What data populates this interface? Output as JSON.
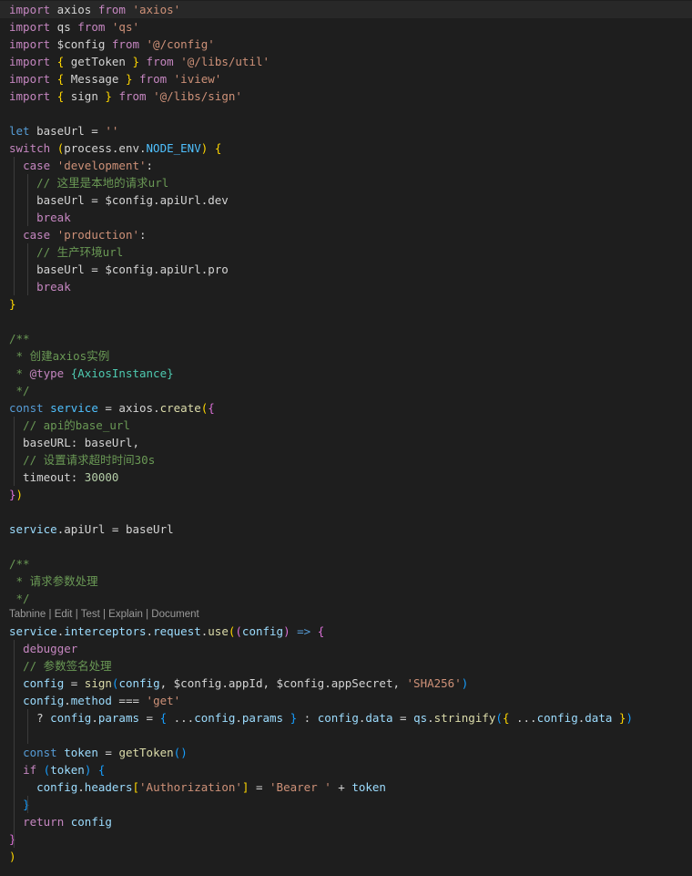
{
  "theme": {
    "background": "#1e1e1e",
    "current_line": "#282828",
    "colors": {
      "kw": "#c586c0",
      "kw2": "#569cd6",
      "str": "#ce9178",
      "var": "#9cdcfe",
      "fn": "#dcdcaa",
      "cls": "#4ec9b0",
      "num": "#b5cea8",
      "comment": "#6a9955",
      "const": "#4fc1ff",
      "plain": "#d4d4d4",
      "b1": "#ffd700",
      "b2": "#da70d6",
      "b3": "#179fff",
      "docTag": "#c586c0"
    }
  },
  "codelens": [
    "Tabnine",
    "Edit",
    "Test",
    "Explain",
    "Document"
  ],
  "lines": [
    [
      [
        "kw",
        "import"
      ],
      [
        "plain",
        " axios "
      ],
      [
        "kw",
        "from"
      ],
      [
        "plain",
        " "
      ],
      [
        "str",
        "'axios'"
      ]
    ],
    [
      [
        "kw",
        "import"
      ],
      [
        "plain",
        " qs "
      ],
      [
        "kw",
        "from"
      ],
      [
        "plain",
        " "
      ],
      [
        "str",
        "'qs'"
      ]
    ],
    [
      [
        "kw",
        "import"
      ],
      [
        "plain",
        " $config "
      ],
      [
        "kw",
        "from"
      ],
      [
        "plain",
        " "
      ],
      [
        "str",
        "'@/config'"
      ]
    ],
    [
      [
        "kw",
        "import"
      ],
      [
        "plain",
        " "
      ],
      [
        "b1",
        "{"
      ],
      [
        "plain",
        " getToken "
      ],
      [
        "b1",
        "}"
      ],
      [
        "plain",
        " "
      ],
      [
        "kw",
        "from"
      ],
      [
        "plain",
        " "
      ],
      [
        "str",
        "'@/libs/util'"
      ]
    ],
    [
      [
        "kw",
        "import"
      ],
      [
        "plain",
        " "
      ],
      [
        "b1",
        "{"
      ],
      [
        "plain",
        " Message "
      ],
      [
        "b1",
        "}"
      ],
      [
        "plain",
        " "
      ],
      [
        "kw",
        "from"
      ],
      [
        "plain",
        " "
      ],
      [
        "str",
        "'iview'"
      ]
    ],
    [
      [
        "kw",
        "import"
      ],
      [
        "plain",
        " "
      ],
      [
        "b1",
        "{"
      ],
      [
        "plain",
        " sign "
      ],
      [
        "b1",
        "}"
      ],
      [
        "plain",
        " "
      ],
      [
        "kw",
        "from"
      ],
      [
        "plain",
        " "
      ],
      [
        "str",
        "'@/libs/sign'"
      ]
    ],
    [],
    [
      [
        "kw2",
        "let"
      ],
      [
        "plain",
        " baseUrl = "
      ],
      [
        "str",
        "''"
      ]
    ],
    [
      [
        "kw",
        "switch"
      ],
      [
        "plain",
        " "
      ],
      [
        "b1",
        "("
      ],
      [
        "plain",
        "process.env."
      ],
      [
        "const",
        "NODE_ENV"
      ],
      [
        "b1",
        ")"
      ],
      [
        "plain",
        " "
      ],
      [
        "b1",
        "{"
      ]
    ],
    [
      [
        "plain",
        "  "
      ],
      [
        "kw",
        "case"
      ],
      [
        "plain",
        " "
      ],
      [
        "str",
        "'development'"
      ],
      [
        "plain",
        ":"
      ]
    ],
    [
      [
        "plain",
        "    "
      ],
      [
        "comment",
        "// 这里是本地的请求url"
      ]
    ],
    [
      [
        "plain",
        "    baseUrl = $config.apiUrl.dev"
      ]
    ],
    [
      [
        "plain",
        "    "
      ],
      [
        "kw",
        "break"
      ]
    ],
    [
      [
        "plain",
        "  "
      ],
      [
        "kw",
        "case"
      ],
      [
        "plain",
        " "
      ],
      [
        "str",
        "'production'"
      ],
      [
        "plain",
        ":"
      ]
    ],
    [
      [
        "plain",
        "    "
      ],
      [
        "comment",
        "// 生产环境url"
      ]
    ],
    [
      [
        "plain",
        "    baseUrl = $config.apiUrl.pro"
      ]
    ],
    [
      [
        "plain",
        "    "
      ],
      [
        "kw",
        "break"
      ]
    ],
    [
      [
        "b1",
        "}"
      ]
    ],
    [],
    [
      [
        "comment",
        "/**"
      ]
    ],
    [
      [
        "comment",
        " * 创建axios实例"
      ]
    ],
    [
      [
        "comment",
        " * "
      ],
      [
        "docTag",
        "@type"
      ],
      [
        "comment",
        " "
      ],
      [
        "cls",
        "{AxiosInstance}"
      ]
    ],
    [
      [
        "comment",
        " */"
      ]
    ],
    [
      [
        "kw2",
        "const"
      ],
      [
        "plain",
        " "
      ],
      [
        "const",
        "service"
      ],
      [
        "plain",
        " = axios."
      ],
      [
        "fn",
        "create"
      ],
      [
        "b1",
        "("
      ],
      [
        "b2",
        "{"
      ]
    ],
    [
      [
        "plain",
        "  "
      ],
      [
        "comment",
        "// api的base_url"
      ]
    ],
    [
      [
        "plain",
        "  baseURL: baseUrl,"
      ]
    ],
    [
      [
        "plain",
        "  "
      ],
      [
        "comment",
        "// 设置请求超时时间30s"
      ]
    ],
    [
      [
        "plain",
        "  timeout: "
      ],
      [
        "num",
        "30000"
      ]
    ],
    [
      [
        "b2",
        "}"
      ],
      [
        "b1",
        ")"
      ]
    ],
    [],
    [
      [
        "var",
        "service"
      ],
      [
        "plain",
        ".apiUrl = baseUrl"
      ]
    ],
    [],
    [
      [
        "comment",
        "/**"
      ]
    ],
    [
      [
        "comment",
        " * 请求参数处理"
      ]
    ],
    [
      [
        "comment",
        " */"
      ]
    ],
    [
      [
        "var",
        "service"
      ],
      [
        "plain",
        "."
      ],
      [
        "var",
        "interceptors"
      ],
      [
        "plain",
        "."
      ],
      [
        "var",
        "request"
      ],
      [
        "plain",
        "."
      ],
      [
        "fn",
        "use"
      ],
      [
        "b1",
        "("
      ],
      [
        "b2",
        "("
      ],
      [
        "var",
        "config"
      ],
      [
        "b2",
        ")"
      ],
      [
        "plain",
        " "
      ],
      [
        "kw2",
        "=>"
      ],
      [
        "plain",
        " "
      ],
      [
        "b2",
        "{"
      ]
    ],
    [
      [
        "plain",
        "  "
      ],
      [
        "kw",
        "debugger"
      ]
    ],
    [
      [
        "plain",
        "  "
      ],
      [
        "comment",
        "// 参数签名处理"
      ]
    ],
    [
      [
        "plain",
        "  "
      ],
      [
        "var",
        "config"
      ],
      [
        "plain",
        " = "
      ],
      [
        "fn",
        "sign"
      ],
      [
        "b3",
        "("
      ],
      [
        "var",
        "config"
      ],
      [
        "plain",
        ", $config.appId, $config.appSecret, "
      ],
      [
        "str",
        "'SHA256'"
      ],
      [
        "b3",
        ")"
      ]
    ],
    [
      [
        "plain",
        "  "
      ],
      [
        "var",
        "config"
      ],
      [
        "plain",
        "."
      ],
      [
        "var",
        "method"
      ],
      [
        "plain",
        " === "
      ],
      [
        "str",
        "'get'"
      ]
    ],
    [
      [
        "plain",
        "    ? "
      ],
      [
        "var",
        "config"
      ],
      [
        "plain",
        "."
      ],
      [
        "var",
        "params"
      ],
      [
        "plain",
        " = "
      ],
      [
        "b3",
        "{"
      ],
      [
        "plain",
        " ..."
      ],
      [
        "var",
        "config"
      ],
      [
        "plain",
        "."
      ],
      [
        "var",
        "params"
      ],
      [
        "plain",
        " "
      ],
      [
        "b3",
        "}"
      ],
      [
        "plain",
        " : "
      ],
      [
        "var",
        "config"
      ],
      [
        "plain",
        "."
      ],
      [
        "var",
        "data"
      ],
      [
        "plain",
        " = "
      ],
      [
        "var",
        "qs"
      ],
      [
        "plain",
        "."
      ],
      [
        "fn",
        "stringify"
      ],
      [
        "b3",
        "("
      ],
      [
        "b1",
        "{"
      ],
      [
        "plain",
        " ..."
      ],
      [
        "var",
        "config"
      ],
      [
        "plain",
        "."
      ],
      [
        "var",
        "data"
      ],
      [
        "plain",
        " "
      ],
      [
        "b1",
        "}"
      ],
      [
        "b3",
        ")"
      ]
    ],
    [],
    [
      [
        "plain",
        "  "
      ],
      [
        "kw2",
        "const"
      ],
      [
        "plain",
        " "
      ],
      [
        "var",
        "token"
      ],
      [
        "plain",
        " = "
      ],
      [
        "fn",
        "getToken"
      ],
      [
        "b3",
        "()"
      ]
    ],
    [
      [
        "plain",
        "  "
      ],
      [
        "kw",
        "if"
      ],
      [
        "plain",
        " "
      ],
      [
        "b3",
        "("
      ],
      [
        "var",
        "token"
      ],
      [
        "b3",
        ")"
      ],
      [
        "plain",
        " "
      ],
      [
        "b3",
        "{"
      ]
    ],
    [
      [
        "plain",
        "    "
      ],
      [
        "var",
        "config"
      ],
      [
        "plain",
        "."
      ],
      [
        "var",
        "headers"
      ],
      [
        "b1",
        "["
      ],
      [
        "str",
        "'Authorization'"
      ],
      [
        "b1",
        "]"
      ],
      [
        "plain",
        " = "
      ],
      [
        "str",
        "'Bearer '"
      ],
      [
        "plain",
        " + "
      ],
      [
        "var",
        "token"
      ]
    ],
    [
      [
        "plain",
        "  "
      ],
      [
        "b3",
        "}"
      ]
    ],
    [
      [
        "plain",
        "  "
      ],
      [
        "kw",
        "return"
      ],
      [
        "plain",
        " "
      ],
      [
        "var",
        "config"
      ]
    ],
    [
      [
        "b2",
        "}"
      ]
    ],
    [
      [
        "b1",
        ")"
      ]
    ]
  ]
}
